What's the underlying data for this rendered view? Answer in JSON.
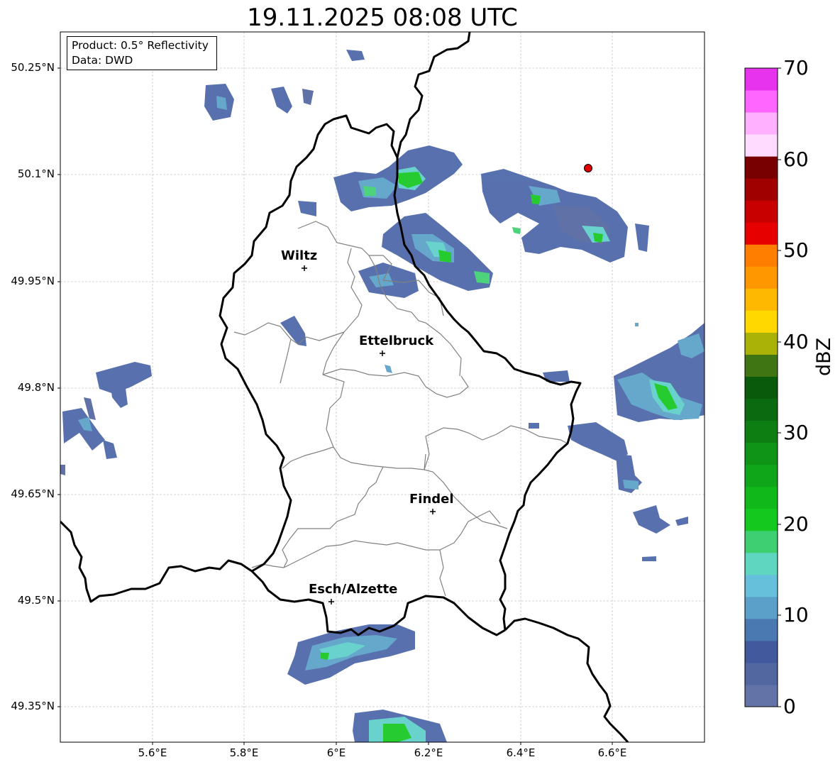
{
  "title": "19.11.2025 08:08 UTC",
  "info": {
    "product": "Product: 0.5° Reflectivity",
    "data_source": "Data: DWD"
  },
  "axes": {
    "lat_labels": [
      "50.25°N",
      "50.1°N",
      "49.95°N",
      "49.8°N",
      "49.65°N",
      "49.5°N",
      "49.35°N"
    ],
    "lon_labels": [
      "5.6°E",
      "5.8°E",
      "6°E",
      "6.2°E",
      "6.4°E",
      "6.6°E"
    ]
  },
  "cities": [
    {
      "name": "Wiltz"
    },
    {
      "name": "Ettelbruck"
    },
    {
      "name": "Findel"
    },
    {
      "name": "Esch/Alzette"
    }
  ],
  "colorbar": {
    "label": "dBZ",
    "ticks": [
      "0",
      "10",
      "20",
      "30",
      "40",
      "50",
      "60",
      "70"
    ],
    "colors": [
      "#6373a8",
      "#5266a0",
      "#42599e",
      "#4a78b0",
      "#5aa0c8",
      "#66c0dc",
      "#5ed6c0",
      "#3ed070",
      "#14c81e",
      "#10b81a",
      "#10a61a",
      "#0f9416",
      "#0d7f12",
      "#0a6a10",
      "#0a5a0c",
      "#3f7512",
      "#aab208",
      "#ffd800",
      "#ffb800",
      "#ff9800",
      "#ff7e00",
      "#e60000",
      "#c80000",
      "#a00000",
      "#780000",
      "#ffdcff",
      "#ffb0ff",
      "#ff66ff",
      "#e833ee"
    ]
  },
  "colors": {
    "radar_blue": "#4a66a8",
    "radar_cyan": "#5ecfc8",
    "radar_green": "#14c81e",
    "country_border": "#000000",
    "canton_border": "#808080",
    "marker_red": "#e00000"
  }
}
